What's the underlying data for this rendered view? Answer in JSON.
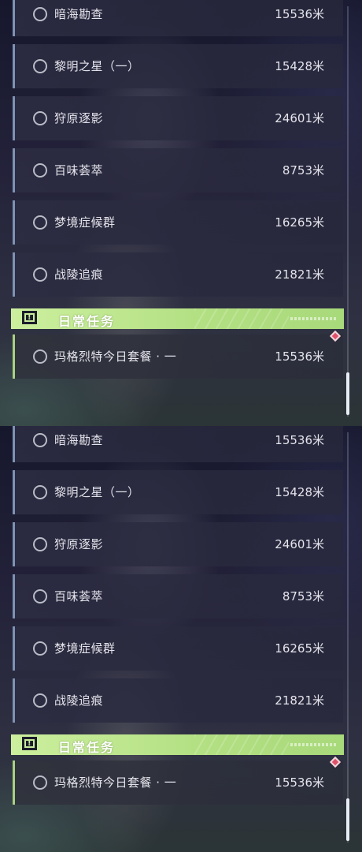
{
  "quest_list": {
    "rows": [
      {
        "name": "暗海勘查",
        "distance": "15536米"
      },
      {
        "name": "黎明之星（一）",
        "distance": "15428米"
      },
      {
        "name": "狩原逐影",
        "distance": "24601米"
      },
      {
        "name": "百味荟萃",
        "distance": "8753米"
      },
      {
        "name": "梦境症候群",
        "distance": "16265米"
      },
      {
        "name": "战陵追痕",
        "distance": "21821米"
      }
    ],
    "daily_section": {
      "title": "日常任务",
      "icon": "exclamation-icon",
      "rows": [
        {
          "name": "玛格烈特今日套餐 · 一",
          "distance": "15536米"
        }
      ]
    }
  },
  "colors": {
    "section_accent": "#b2df82",
    "row_border": "#7d93b3",
    "daily_row_border": "#a9d182",
    "tracking_diamond": "#e0506a"
  }
}
